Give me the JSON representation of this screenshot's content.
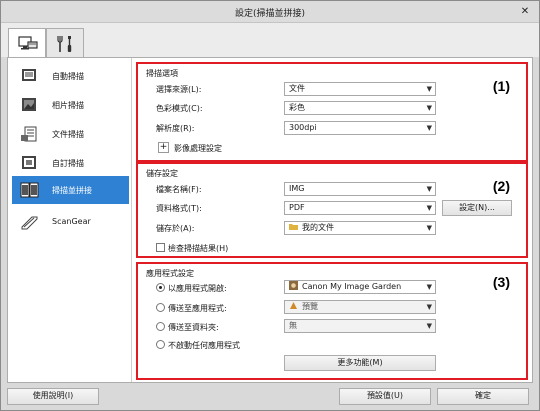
{
  "window": {
    "title": "設定(掃描並拼接)",
    "close_glyph": "✕"
  },
  "tabs": [
    {
      "name": "scan-from-computer",
      "icon": "scanner-monitor-icon",
      "active": true
    },
    {
      "name": "general-settings",
      "icon": "tools-icon",
      "active": false
    }
  ],
  "sidebar": {
    "items": [
      {
        "label": "自動掃描",
        "icon": "auto-scan-icon",
        "selected": false
      },
      {
        "label": "相片掃描",
        "icon": "photo-scan-icon",
        "selected": false
      },
      {
        "label": "文件掃描",
        "icon": "document-scan-icon",
        "selected": false
      },
      {
        "label": "自訂掃描",
        "icon": "custom-scan-icon",
        "selected": false
      },
      {
        "label": "掃描並拼接",
        "icon": "stitch-scan-icon",
        "selected": true
      },
      {
        "label": "ScanGear",
        "icon": "scangear-icon",
        "selected": false
      }
    ]
  },
  "scan_options": {
    "heading": "掃描選項",
    "number": "(1)",
    "source_label": "選擇來源(L):",
    "source_value": "文件",
    "color_mode_label": "色彩模式(C):",
    "color_mode_value": "彩色",
    "resolution_label": "解析度(R):",
    "resolution_value": "300dpi",
    "image_processing_label": "影像處理設定",
    "expand_glyph": "+"
  },
  "save_settings": {
    "heading": "儲存設定",
    "number": "(2)",
    "file_name_label": "檔案名稱(F):",
    "file_name_value": "IMG",
    "data_format_label": "資料格式(T):",
    "data_format_value": "PDF",
    "format_settings_button": "設定(N)...",
    "save_in_label": "儲存於(A):",
    "save_in_value": "我的文件",
    "check_results_label": "檢查掃描結果(H)",
    "check_results_checked": false
  },
  "app_settings": {
    "heading": "應用程式設定",
    "number": "(3)",
    "open_with_label": "以應用程式開啟:",
    "open_with_value": "Canon My Image Garden",
    "send_to_app_label": "傳送至應用程式:",
    "send_to_app_value": "預覽",
    "send_to_folder_label": "傳送至資料夾:",
    "send_to_folder_value": "無",
    "do_not_start_label": "不啟動任何應用程式",
    "more_functions_button": "更多功能(M)",
    "selected_option": "open_with"
  },
  "footer": {
    "help_button": "使用說明(I)",
    "defaults_button": "預設值(U)",
    "ok_button": "確定"
  },
  "colors": {
    "highlight": "#e01b24",
    "selection": "#2f82d3"
  }
}
